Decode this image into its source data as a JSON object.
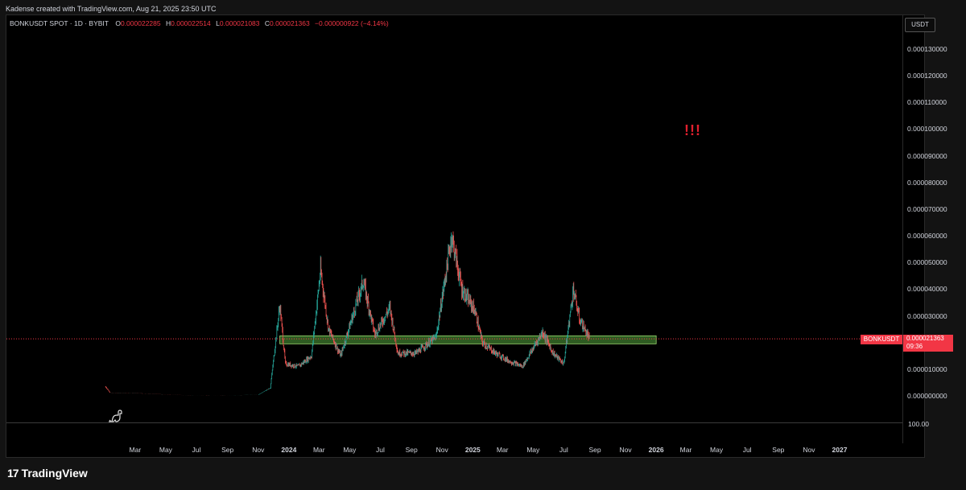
{
  "credit": "Kadense created with TradingView.com, Aug 21, 2025 23:50 UTC",
  "legend": {
    "symbol": "BONKUSDT SPOT · 1D · BYBIT",
    "open_label": "O",
    "open": "0.000022285",
    "high_label": "H",
    "high": "0.000022514",
    "low_label": "L",
    "low": "0.000021083",
    "close_label": "C",
    "close": "0.000021363",
    "change": "−0.000000922 (−4.14%)"
  },
  "currency": "USDT",
  "annotation": "!!!",
  "price_tag": {
    "symbol": "BONKUSDT",
    "price": "0.000021363",
    "countdown": "09:36"
  },
  "lower_pane_label": "100.00",
  "brand": "TradingView",
  "colors": {
    "up": "#26a69a",
    "down": "#ef5350",
    "zone_fill": "#3d7a2e",
    "zone_border": "#9ad86f",
    "accent": "#f23645"
  },
  "chart_data": {
    "type": "candlestick",
    "symbol": "BONKUSDT",
    "interval": "1D",
    "exchange": "BYBIT",
    "y_ticks": [
      "0.000130000",
      "0.000120000",
      "0.000110000",
      "0.000100000",
      "0.000090000",
      "0.000080000",
      "0.000070000",
      "0.000060000",
      "0.000050000",
      "0.000040000",
      "0.000030000",
      "0.000020000",
      "0.000010000",
      "0.000000000"
    ],
    "x_ticks": [
      "Mar",
      "May",
      "Jul",
      "Sep",
      "Nov",
      "2024",
      "Mar",
      "May",
      "Jul",
      "Sep",
      "Nov",
      "2025",
      "Mar",
      "May",
      "Jul",
      "Sep",
      "Nov",
      "2026",
      "Mar",
      "May",
      "Jul",
      "Sep",
      "Nov",
      "2027"
    ],
    "ylim": [
      0,
      0.00013
    ],
    "last_price": 2.1363e-05,
    "support_zone": {
      "low": 1.95e-05,
      "high": 2.25e-05,
      "from": "2023-12-14",
      "to": "2026-01-01"
    },
    "approx_closes": [
      [
        "2023-01-01",
        3.5e-06
      ],
      [
        "2023-01-10",
        1.2e-06
      ],
      [
        "2023-03-01",
        1e-06
      ],
      [
        "2023-06-01",
        3e-07
      ],
      [
        "2023-09-01",
        2e-07
      ],
      [
        "2023-11-01",
        4e-07
      ],
      [
        "2023-11-25",
        3e-06
      ],
      [
        "2023-12-14",
        3.4e-05
      ],
      [
        "2023-12-25",
        1.2e-05
      ],
      [
        "2024-01-20",
        1.1e-05
      ],
      [
        "2024-02-15",
        1.5e-05
      ],
      [
        "2024-03-04",
        4.7e-05
      ],
      [
        "2024-03-20",
        2.5e-05
      ],
      [
        "2024-04-13",
        1.5e-05
      ],
      [
        "2024-05-28",
        4.3e-05
      ],
      [
        "2024-06-20",
        2.3e-05
      ],
      [
        "2024-07-20",
        3.3e-05
      ],
      [
        "2024-08-05",
        1.6e-05
      ],
      [
        "2024-09-10",
        1.6e-05
      ],
      [
        "2024-10-20",
        2.2e-05
      ],
      [
        "2024-11-20",
        6e-05
      ],
      [
        "2024-12-10",
        4e-05
      ],
      [
        "2025-01-05",
        3.2e-05
      ],
      [
        "2025-01-20",
        2e-05
      ],
      [
        "2025-02-15",
        1.6e-05
      ],
      [
        "2025-03-15",
        1.3e-05
      ],
      [
        "2025-04-10",
        1.1e-05
      ],
      [
        "2025-05-20",
        2.4e-05
      ],
      [
        "2025-06-10",
        1.6e-05
      ],
      [
        "2025-07-01",
        1.2e-05
      ],
      [
        "2025-07-20",
        4e-05
      ],
      [
        "2025-08-01",
        2.9e-05
      ],
      [
        "2025-08-21",
        2.14e-05
      ]
    ]
  }
}
